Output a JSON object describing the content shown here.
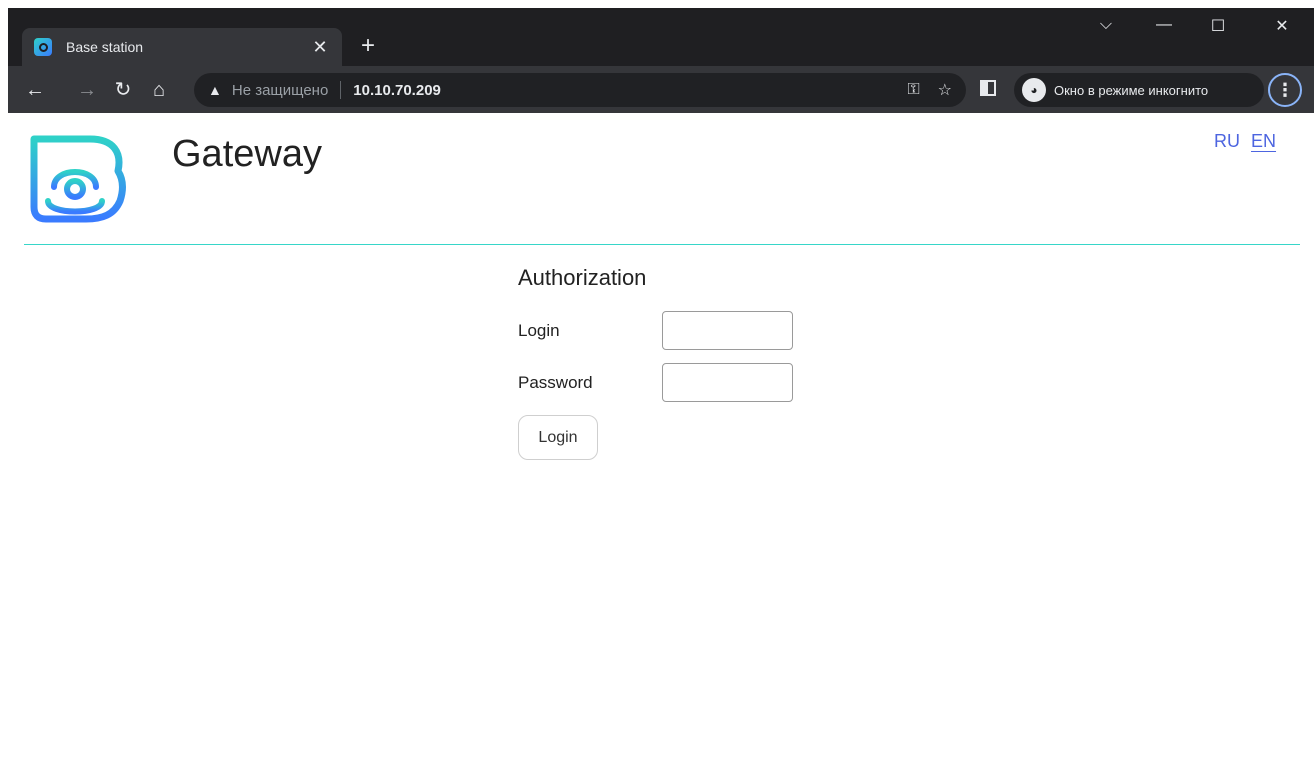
{
  "browser": {
    "tab_title": "Base station",
    "not_secure_label": "Не защищено",
    "url": "10.10.70.209",
    "incognito_label": "Окно в режиме инкогнито",
    "icons": [
      "back-icon",
      "forward-icon",
      "reload-icon",
      "home-icon",
      "warning-icon",
      "key-icon",
      "star-icon",
      "side-panel-icon",
      "incognito-icon",
      "menu-icon",
      "close-icon",
      "new-tab-icon",
      "minimize-icon",
      "maximize-icon",
      "chevron-down-icon"
    ]
  },
  "header": {
    "brand": "Gateway",
    "languages": [
      "RU",
      "EN"
    ],
    "active_language": "EN"
  },
  "auth": {
    "title": "Authorization",
    "login_label": "Login",
    "password_label": "Password",
    "submit_label": "Login"
  },
  "colors": {
    "accent_line": "#37d6c9",
    "link": "#4d65e0",
    "logo_gradient_start": "#2fd1c8",
    "logo_gradient_end": "#3a7bff"
  }
}
